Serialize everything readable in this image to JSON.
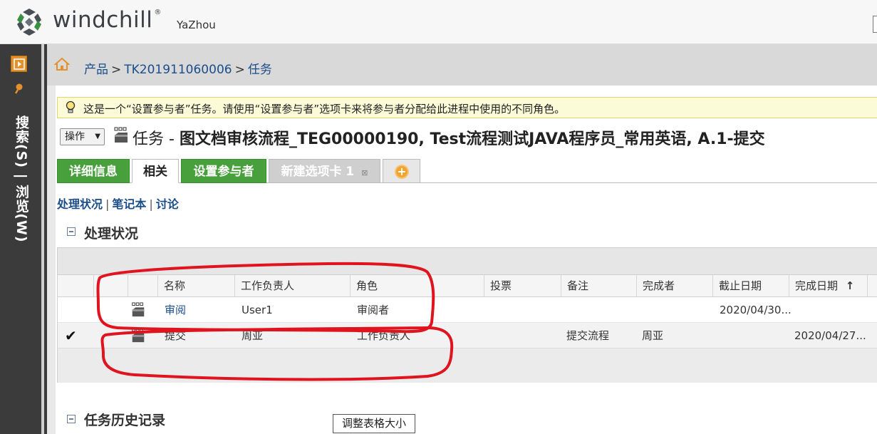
{
  "header": {
    "brand": "windchill",
    "user": "YaZhou"
  },
  "leftnav": {
    "vertical_label": "搜索(S) | 浏览(W)"
  },
  "breadcrumb": {
    "items": [
      "产品",
      "TK201911060006",
      "任务"
    ],
    "separator": ">"
  },
  "tip": {
    "text": "这是一个“设置参与者”任务。请使用“设置参与者”选项卡来将参与者分配给此进程中使用的不同角色。"
  },
  "title_bar": {
    "actions_label": "操作",
    "title_prefix": "任务 - ",
    "title_main": "图文档审核流程_TEG00000190, Test流程测试JAVA程序员_常用英语, A.1-提交"
  },
  "tabs": [
    {
      "label": "详细信息"
    },
    {
      "label": "相关"
    },
    {
      "label": "设置参与者"
    },
    {
      "label": "新建选项卡 1"
    }
  ],
  "sublinks": [
    "处理状况",
    "笔记本",
    "讨论"
  ],
  "sections": {
    "status": "处理状况",
    "history": "任务历史记录"
  },
  "table": {
    "columns": [
      "名称",
      "工作负责人",
      "角色",
      "投票",
      "备注",
      "完成者",
      "截止日期",
      "完成日期"
    ],
    "sort_indicator": "↑",
    "rows": [
      {
        "check": "",
        "name": "审阅",
        "owner": "User1",
        "role": "审阅者",
        "vote": "",
        "note": "",
        "done_by": "",
        "due": "2020/04/30...",
        "completed": ""
      },
      {
        "check": "✔",
        "name": "提交",
        "owner": "周亚",
        "role": "工作负责人",
        "vote": "",
        "note": "提交流程",
        "done_by": "周亚",
        "due": "",
        "completed": "2020/04/27..."
      }
    ]
  },
  "tooltip": {
    "text": "调整表格大小"
  },
  "colors": {
    "tab_green": "#47a03c",
    "link_blue": "#1a4d8a",
    "nav_dark": "#3b3b3b",
    "annotation_red": "#e0141e"
  }
}
